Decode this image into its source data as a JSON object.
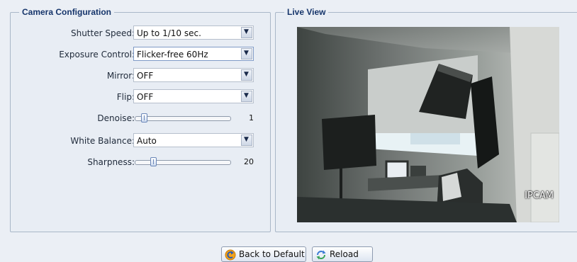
{
  "camera_config": {
    "title": "Camera Configuration",
    "shutter": {
      "label": "Shutter Speed:",
      "value": "Up to 1/10 sec."
    },
    "exposure": {
      "label": "Exposure Control:",
      "value": "Flicker-free 60Hz"
    },
    "mirror": {
      "label": "Mirror:",
      "value": "OFF"
    },
    "flip": {
      "label": "Flip:",
      "value": "OFF"
    },
    "denoise": {
      "label": "Denoise:",
      "value": "1",
      "level": 0.1
    },
    "white_balance": {
      "label": "White Balance:",
      "value": "Auto"
    },
    "sharpness": {
      "label": "Sharpness:",
      "value": "20",
      "level": 0.2
    }
  },
  "live_view": {
    "title": "Live View",
    "osd_text": "IPCAM"
  },
  "buttons": {
    "back_to_default": "Back to Default",
    "reload": "Reload"
  },
  "icons": {
    "dropdown": "chevron-down-icon",
    "back": "back-arrow-icon",
    "reload": "reload-icon"
  },
  "colors": {
    "background": "#ebeff5",
    "legend": "#16356b",
    "panel_border": "#a9b7c8"
  }
}
